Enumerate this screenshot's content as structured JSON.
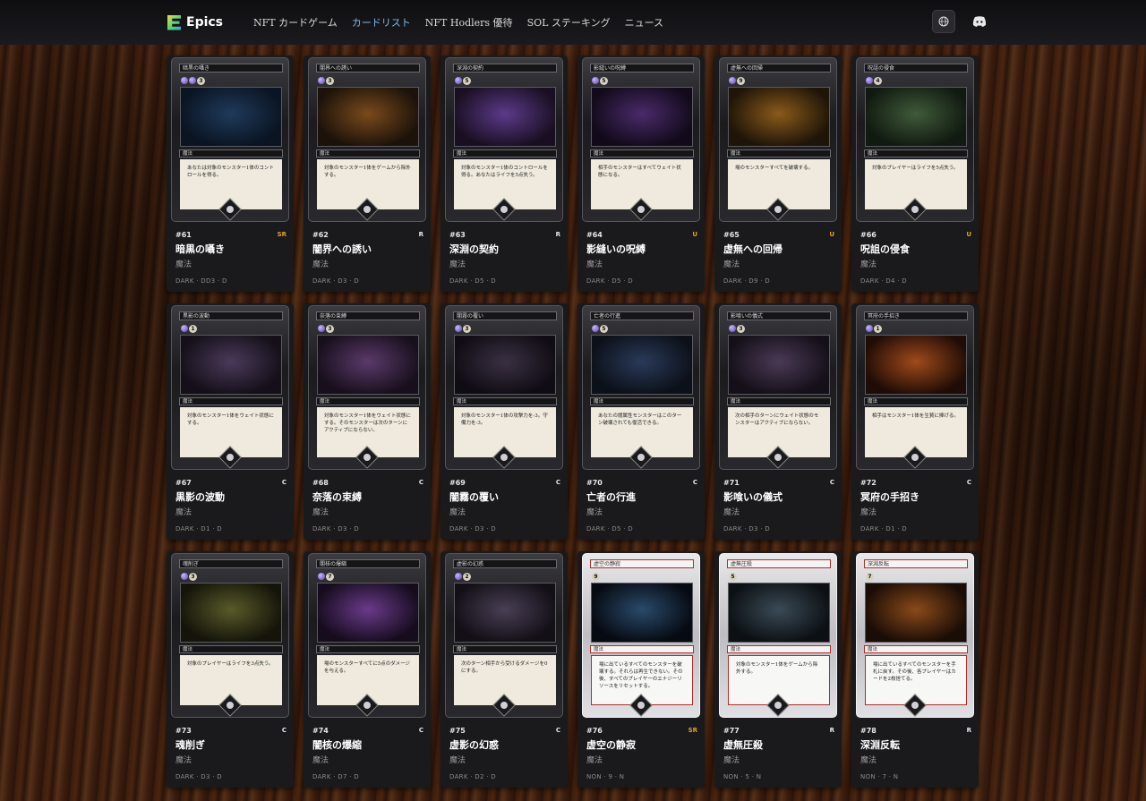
{
  "header": {
    "brand": "Epics",
    "nav": [
      {
        "label": "NFT カードゲーム",
        "active": false
      },
      {
        "label": "カードリスト",
        "active": true
      },
      {
        "label": "NFT Hodlers 優待",
        "active": false
      },
      {
        "label": "SOL ステーキング",
        "active": false
      },
      {
        "label": "ニュース",
        "active": false
      }
    ],
    "icons": [
      "globe-icon",
      "discord-icon"
    ]
  },
  "colors": {
    "accent_link": "#7fb8e8",
    "rarity_gold": "#e0a321"
  },
  "cards": [
    {
      "num": "#61",
      "name": "暗黒の囁き",
      "type": "魔法",
      "rarity": "SR",
      "stats": "DARK · DD3 · D",
      "cost": "3",
      "gems": 2,
      "text": "あなたは対象のモンスター1体のコントロールを得る。",
      "art": [
        "#1f3a5a",
        "#0a1422"
      ],
      "silver": false
    },
    {
      "num": "#62",
      "name": "闇界への誘い",
      "type": "魔法",
      "rarity": "R",
      "stats": "DARK · D3 · D",
      "cost": "3",
      "gems": 1,
      "text": "対象のモンスター1体をゲームから除外する。",
      "art": [
        "#7a4a1c",
        "#1c120a"
      ],
      "silver": false
    },
    {
      "num": "#63",
      "name": "深淵の契約",
      "type": "魔法",
      "rarity": "R",
      "stats": "DARK · D5 · D",
      "cost": "5",
      "gems": 1,
      "text": "対象のモンスター1体のコントロールを得る。あなたはライフを5点失う。",
      "art": [
        "#5b3a8a",
        "#1a0f22"
      ],
      "silver": false
    },
    {
      "num": "#64",
      "name": "影縫いの呪縛",
      "type": "魔法",
      "rarity": "U",
      "stats": "DARK · D5 · D",
      "cost": "5",
      "gems": 1,
      "text": "相手のモンスターはすべてウェイト状態になる。",
      "art": [
        "#4a2a6a",
        "#120a1a"
      ],
      "silver": false
    },
    {
      "num": "#65",
      "name": "虚無への回帰",
      "type": "魔法",
      "rarity": "U",
      "stats": "DARK · D9 · D",
      "cost": "9",
      "gems": 1,
      "text": "場のモンスターすべてを破壊する。",
      "art": [
        "#8a5a1a",
        "#1e1408"
      ],
      "silver": false
    },
    {
      "num": "#66",
      "name": "呪詛の侵食",
      "type": "魔法",
      "rarity": "U",
      "stats": "DARK · D4 · D",
      "cost": "4",
      "gems": 1,
      "text": "対象のプレイヤーはライフを5点失う。",
      "art": [
        "#3f5a3a",
        "#111a10"
      ],
      "silver": false
    },
    {
      "num": "#67",
      "name": "黒影の波動",
      "type": "魔法",
      "rarity": "C",
      "stats": "DARK · D1 · D",
      "cost": "1",
      "gems": 1,
      "text": "対象のモンスター1体をウェイト状態にする。",
      "art": [
        "#4a3a5a",
        "#140f18"
      ],
      "silver": false
    },
    {
      "num": "#68",
      "name": "奈落の束縛",
      "type": "魔法",
      "rarity": "C",
      "stats": "DARK · D3 · D",
      "cost": "3",
      "gems": 1,
      "text": "対象のモンスター1体をウェイト状態にする。そのモンスターは次のターンにアクティブにならない。",
      "art": [
        "#5a3a6a",
        "#180f1c"
      ],
      "silver": false
    },
    {
      "num": "#69",
      "name": "闇霧の覆い",
      "type": "魔法",
      "rarity": "C",
      "stats": "DARK · D3 · D",
      "cost": "3",
      "gems": 1,
      "text": "対象のモンスター1体の攻撃力を-3。守備力を-3。",
      "art": [
        "#3a3042",
        "#100c14"
      ],
      "silver": false
    },
    {
      "num": "#70",
      "name": "亡者の行進",
      "type": "魔法",
      "rarity": "C",
      "stats": "DARK · D5 · D",
      "cost": "5",
      "gems": 1,
      "text": "あなたの闇属性モンスターはこのターン破壊されても復活できる。",
      "art": [
        "#2a3a5a",
        "#0c1018"
      ],
      "silver": false
    },
    {
      "num": "#71",
      "name": "影喰いの儀式",
      "type": "魔法",
      "rarity": "C",
      "stats": "DARK · D3 · D",
      "cost": "3",
      "gems": 1,
      "text": "次の相手のターンにウェイト状態のモンスターはアクティブにならない。",
      "art": [
        "#4a3a55",
        "#140f18"
      ],
      "silver": false
    },
    {
      "num": "#72",
      "name": "冥府の手招き",
      "type": "魔法",
      "rarity": "C",
      "stats": "DARK · D1 · D",
      "cost": "1",
      "gems": 1,
      "text": "相手はモンスター1体を生贄に捧げる。",
      "art": [
        "#a04a1a",
        "#200c06"
      ],
      "silver": false
    },
    {
      "num": "#73",
      "name": "魂削ぎ",
      "type": "魔法",
      "rarity": "C",
      "stats": "DARK · D3 · D",
      "cost": "3",
      "gems": 1,
      "text": "対象のプレイヤーはライフを3点失う。",
      "art": [
        "#5a5a2a",
        "#14140a"
      ],
      "silver": false
    },
    {
      "num": "#74",
      "name": "闇核の爆縮",
      "type": "魔法",
      "rarity": "C",
      "stats": "DARK · D7 · D",
      "cost": "7",
      "gems": 1,
      "text": "場のモンスターすべてに5点のダメージを与える。",
      "art": [
        "#6a3a8a",
        "#160c1e"
      ],
      "silver": false
    },
    {
      "num": "#75",
      "name": "虚影の幻惑",
      "type": "魔法",
      "rarity": "C",
      "stats": "DARK · D2 · D",
      "cost": "2",
      "gems": 1,
      "text": "次のターン相手から受けるダメージを0にする。",
      "art": [
        "#4a3f55",
        "#120f16"
      ],
      "silver": false
    },
    {
      "num": "#76",
      "name": "虚空の静寂",
      "type": "魔法",
      "rarity": "SR",
      "stats": "NON · 9 · N",
      "cost": "9",
      "gems": 0,
      "text": "場に出ているすべてのモンスターを破壊する。それらは再生できない。その後、すべてのプレイヤーのエナジーリソースをリセットする。",
      "art": [
        "#2a4a6a",
        "#060a12"
      ],
      "silver": true
    },
    {
      "num": "#77",
      "name": "虚無圧殺",
      "type": "魔法",
      "rarity": "R",
      "stats": "NON · 5 · N",
      "cost": "5",
      "gems": 0,
      "text": "対象のモンスター1体をゲームから除外する。",
      "art": [
        "#3a4a55",
        "#0c1014"
      ],
      "silver": true
    },
    {
      "num": "#78",
      "name": "深淵反転",
      "type": "魔法",
      "rarity": "R",
      "stats": "NON · 7 · N",
      "cost": "7",
      "gems": 0,
      "text": "場に出ているすべてのモンスターを手札に戻す。その後、各プレイヤーはカードを2枚捨てる。",
      "art": [
        "#8a4a1a",
        "#1a0c06"
      ],
      "silver": true
    }
  ]
}
